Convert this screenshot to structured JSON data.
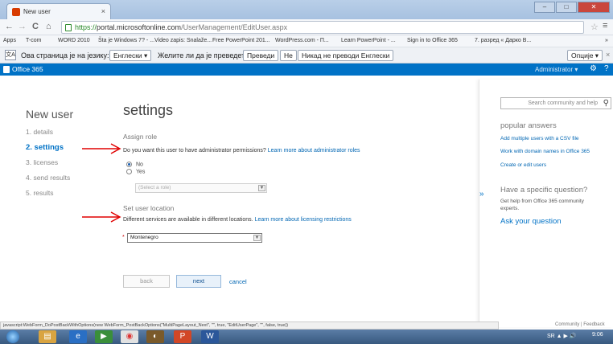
{
  "browser": {
    "tab_title": "New user",
    "tab_close": "×",
    "window_buttons": {
      "minimize": "–",
      "maximize": "□",
      "close": "✕"
    },
    "url_https": "https://",
    "url_host": "portal.microsoftonline.com",
    "url_path": "/UserManagement/EditUser.aspx",
    "back": "←",
    "forward": "→",
    "reload": "C",
    "home": "⌂",
    "star": "☆",
    "menu": "≡",
    "bookmarks": [
      "Apps",
      "T-com",
      "WORD 2010",
      "Šta je Windows 7? - ...",
      "Video zapis: Snalaže...",
      "Free PowerPoint 201...",
      "WordPress.com - П...",
      "Learn PowerPoint - ...",
      "Sign in to Office 365",
      "7. разред « Дарко В..."
    ],
    "bookmarks_more": "»",
    "status_text": "javascript:WebForm_DoPostBackWithOptions(new WebForm_PostBackOptions(\"MultiPageLayout_Next\", \"\", true, \"EditUserPage\", \"\", false, true))"
  },
  "translate_bar": {
    "icon": "文A",
    "prompt": "Ова страница је на језику:",
    "language": "Енглески ▾",
    "question": "Желите ли да је преведете?",
    "translate_button": "Преведи",
    "no_button": "Не",
    "never_button": "Никад не преводи Енглески",
    "options_button": "Опције ▾",
    "close": "×"
  },
  "o365": {
    "brand": "Office 365",
    "user": "Administrator ▾",
    "gear": "⚙",
    "help": "?"
  },
  "page": {
    "title": "New user",
    "section": "settings",
    "steps": [
      "1.  details",
      "2.  settings",
      "3.  licenses",
      "4.  send results",
      "5.  results"
    ],
    "assign_role": {
      "heading": "Assign role",
      "question": "Do you want this user to have administrator permissions?",
      "learn_more": "Learn more about administrator roles",
      "options": [
        "No",
        "Yes"
      ],
      "selected": "No",
      "role_placeholder": "(Select a role)"
    },
    "location": {
      "heading": "Set user location",
      "description": "Different services are available in different locations.",
      "learn_more": "Learn more about licensing restrictions",
      "required_mark": "*",
      "value": "Montenegro"
    },
    "buttons": {
      "back": "back",
      "next": "next",
      "cancel": "cancel"
    }
  },
  "help_panel": {
    "collapse": "»",
    "search_placeholder": "Search community and help",
    "popular_heading": "popular answers",
    "popular_links": [
      "Add multiple users with a CSV file",
      "Work with domain names in Office 365",
      "Create or edit users"
    ],
    "specific_heading": "Have a specific question?",
    "specific_text": "Get help from Office 365 community experts.",
    "ask_link": "Ask your question"
  },
  "footer": {
    "links": "Community  |  Feedback"
  },
  "taskbar": {
    "tray": "SR  ▲  ▶ 🔊",
    "clock": "9:06"
  },
  "colors": {
    "accent": "#0072c6",
    "arrow": "#e00000"
  }
}
